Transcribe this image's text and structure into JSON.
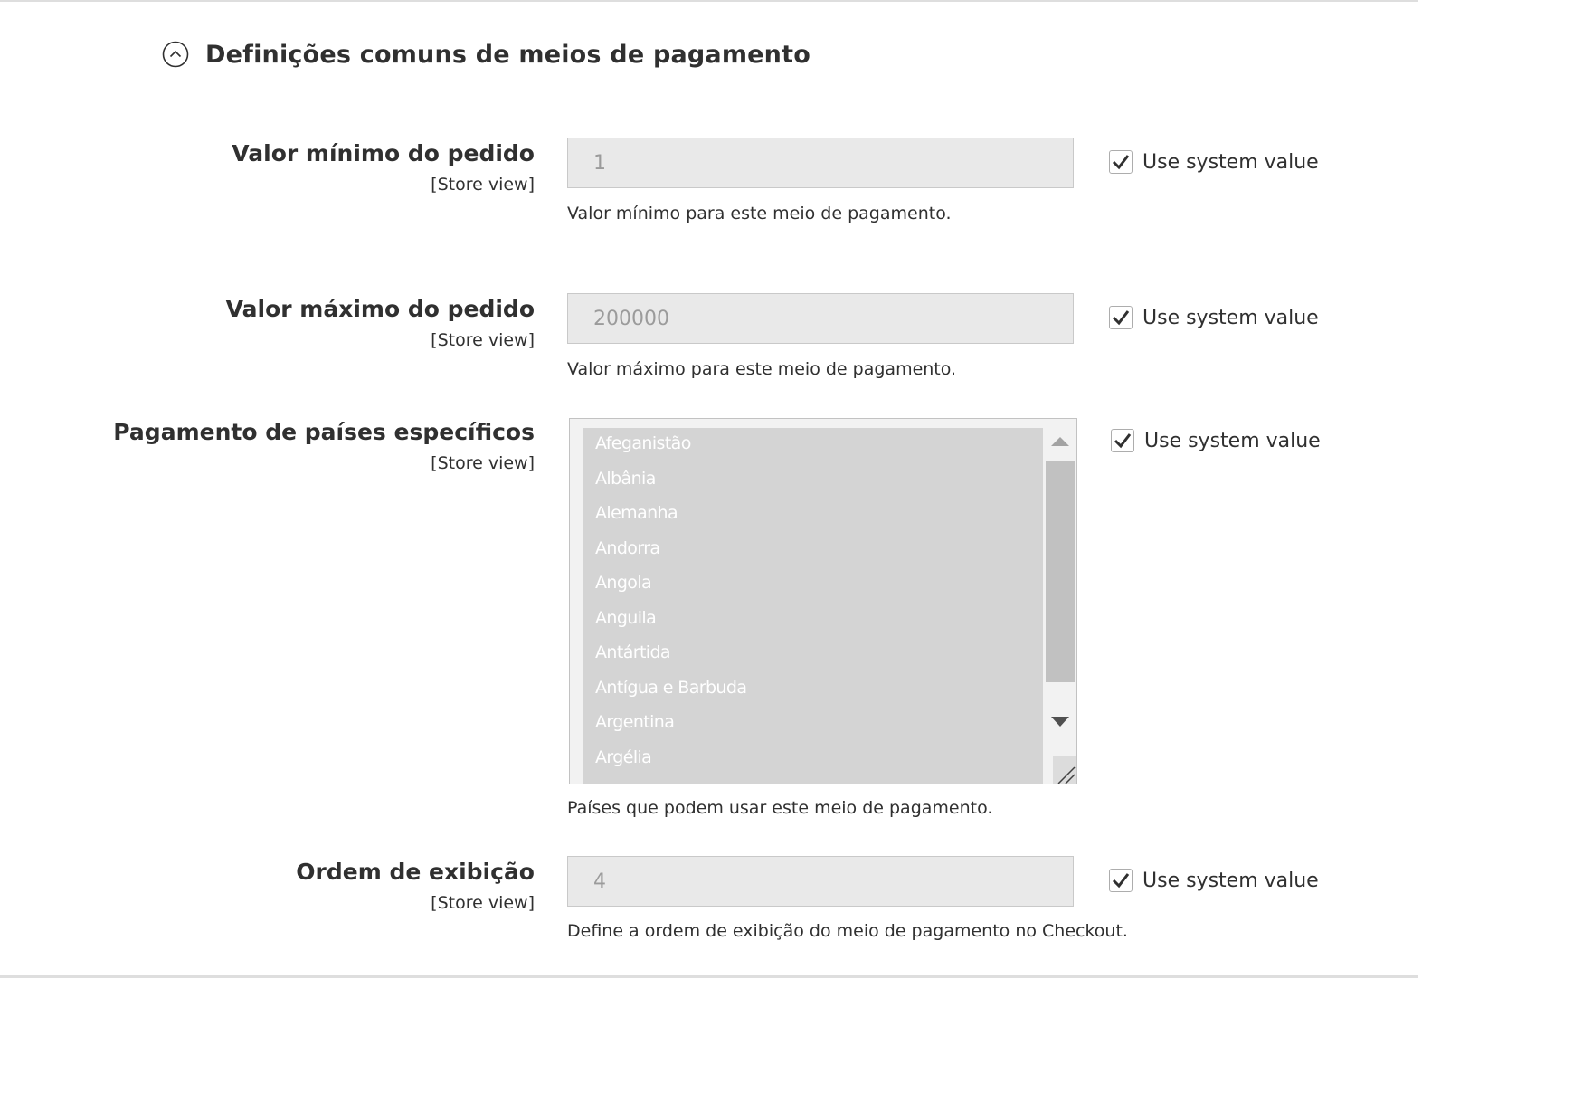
{
  "section": {
    "title": "Definições comuns de meios de pagamento",
    "icon": "chevron-up-circle-icon"
  },
  "fields": {
    "min_order": {
      "label": "Valor mínimo do pedido",
      "scope": "[Store view]",
      "value": "1",
      "note": "Valor mínimo para este meio de pagamento.",
      "use_system_label": "Use system value",
      "use_system_checked": true
    },
    "max_order": {
      "label": "Valor máximo do pedido",
      "scope": "[Store view]",
      "value": "200000",
      "note": "Valor máximo para este meio de pagamento.",
      "use_system_label": "Use system value",
      "use_system_checked": true
    },
    "specific_countries": {
      "label": "Pagamento de países específicos",
      "scope": "[Store view]",
      "options": [
        "Afeganistão",
        "Albânia",
        "Alemanha",
        "Andorra",
        "Angola",
        "Anguila",
        "Antártida",
        "Antígua e Barbuda",
        "Argentina",
        "Argélia"
      ],
      "note": "Países que podem usar este meio de pagamento.",
      "use_system_label": "Use system value",
      "use_system_checked": true
    },
    "sort_order": {
      "label": "Ordem de exibição",
      "scope": "[Store view]",
      "value": "4",
      "note": "Define a ordem de exibição do meio de pagamento no Checkout.",
      "use_system_label": "Use system value",
      "use_system_checked": true
    }
  },
  "colors": {
    "text": "#303030",
    "input_disabled_bg": "#e9e9e9",
    "input_text_disabled": "#9b9b9b",
    "multiselect_bg": "#d4d4d4"
  }
}
